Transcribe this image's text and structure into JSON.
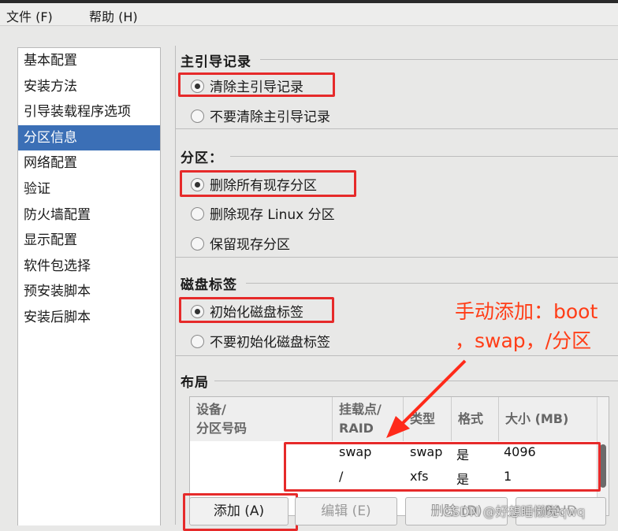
{
  "menu": [
    "文件 (F)",
    "帮助 (H)"
  ],
  "sidebar": {
    "items": [
      "基本配置",
      "安装方法",
      "引导装载程序选项",
      "分区信息",
      "网络配置",
      "验证",
      "防火墙配置",
      "显示配置",
      "软件包选择",
      "预安装脚本",
      "安装后脚本"
    ],
    "selected_index": 3
  },
  "mbr": {
    "title": "主引导记录",
    "options": [
      {
        "label": "清除主引导记录",
        "checked": true
      },
      {
        "label": "不要清除主引导记录",
        "checked": false
      }
    ]
  },
  "partition": {
    "title": "分区：",
    "options": [
      {
        "label": "删除所有现存分区",
        "checked": true
      },
      {
        "label": "删除现存 Linux 分区",
        "checked": false
      },
      {
        "label": "保留现存分区",
        "checked": false
      }
    ]
  },
  "disklabel": {
    "title": "磁盘标签",
    "options": [
      {
        "label": "初始化磁盘标签",
        "checked": true
      },
      {
        "label": "不要初始化磁盘标签",
        "checked": false
      }
    ]
  },
  "annotation": {
    "line1": "手动添加：boot",
    "line2": "，swap，/分区"
  },
  "layout": {
    "title": "布局",
    "columns": {
      "device_a": "设备/",
      "device_b": "分区号码",
      "mount_a": "挂载点/",
      "mount_b": "RAID",
      "type": "类型",
      "format": "格式",
      "size": "大小 (MB)"
    },
    "rows": [
      {
        "mount": "swap",
        "type": "swap",
        "format": "是",
        "size": "4096"
      },
      {
        "mount": "/",
        "type": "xfs",
        "format": "是",
        "size": "1"
      }
    ]
  },
  "buttons": {
    "add": "添加 (A)",
    "edit": "编辑 (E)",
    "delete": "删除 (D)",
    "raid": "RAID"
  },
  "watermark": "CSDN @好想睡懒觉qwq",
  "colors": {
    "accent": "#3b6fb6",
    "annotation_red": "#e62a2a"
  }
}
